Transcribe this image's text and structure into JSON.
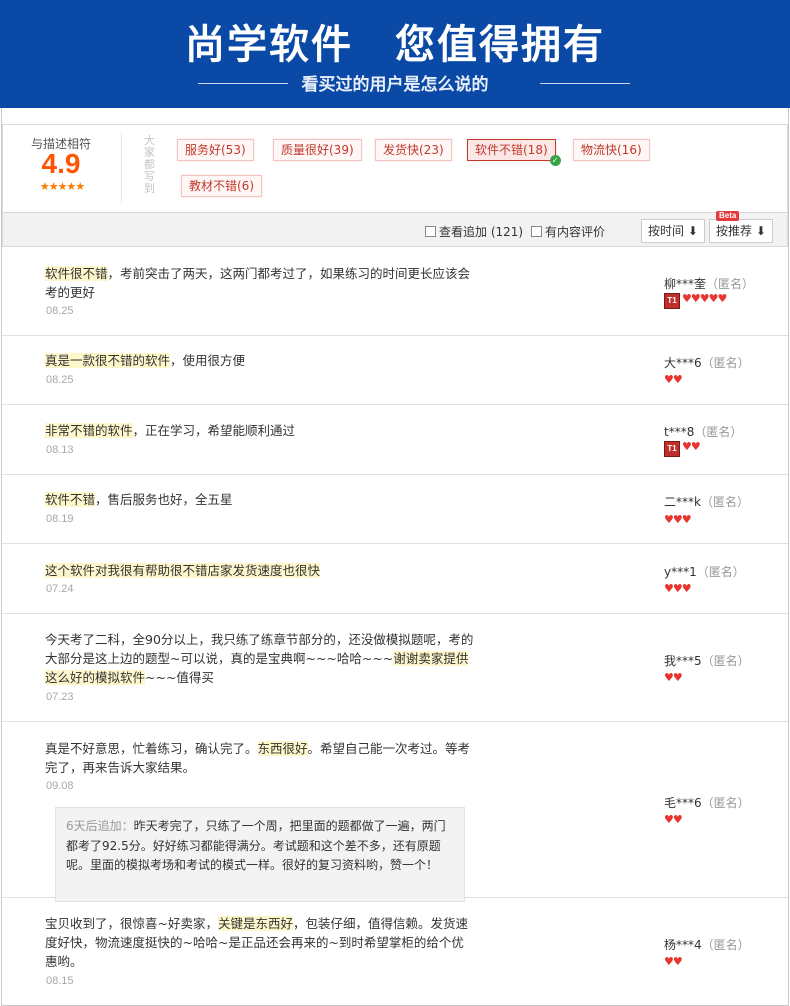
{
  "banner": {
    "title": "尚学软件　您值得拥有",
    "subtitle": "看买过的用户是怎么说的"
  },
  "summary": {
    "score_label": "与描述相符",
    "score": "4.9",
    "stars": "★★★★★",
    "tag_caption": "大家都写到",
    "tags": [
      {
        "label": "服务好(53)",
        "active": false
      },
      {
        "label": "质量很好(39)",
        "active": false
      },
      {
        "label": "发货快(23)",
        "active": false
      },
      {
        "label": "软件不错(18)",
        "active": true
      },
      {
        "label": "物流快(16)",
        "active": false
      },
      {
        "label": "教材不错(6)",
        "active": false
      }
    ]
  },
  "filters": {
    "append_label": "查看追加 (121)",
    "content_label": "有内容评价",
    "sort_time": "按时间",
    "sort_recommend": "按推荐",
    "beta": "Beta"
  },
  "reviews": [
    {
      "text_hl": "软件很不错",
      "text_rest": "，考前突击了两天，这两门都考过了，如果练习的时间更长应该会考的更好",
      "date": "08.25",
      "user": "柳***奎",
      "anon": "（匿名）",
      "badge": "T1",
      "hearts": 5
    },
    {
      "text_hl": "真是一款很不错的软件",
      "text_rest": "，使用很方便",
      "date": "08.25",
      "user": "大***6",
      "anon": "（匿名）",
      "badge": "",
      "hearts": 2
    },
    {
      "text_hl": "非常不错的软件",
      "text_rest": "，正在学习，希望能顺利通过",
      "date": "08.13",
      "user": "t***8",
      "anon": "（匿名）",
      "badge": "T1",
      "hearts": 2
    },
    {
      "text_hl": "软件不错",
      "text_rest": "，售后服务也好，全五星",
      "date": "08.19",
      "user": "二***k",
      "anon": "（匿名）",
      "badge": "",
      "hearts": 3
    },
    {
      "text_hl": "这个软件对我很有帮助很不错店家发货速度也很快",
      "text_rest": "",
      "date": "07.24",
      "user": "y***1",
      "anon": "（匿名）",
      "badge": "",
      "hearts": 3
    },
    {
      "text_pre": "今天考了二科，全90分以上，我只练了练章节部分的，还没做模拟题呢，考的大部分是这上边的题型~可以说，真的是宝典啊~~~哈哈~~~",
      "text_hl": "谢谢卖家提供这么好的模拟软件",
      "text_rest": "~~~值得买",
      "date": "07.23",
      "user": "我***5",
      "anon": "（匿名）",
      "badge": "",
      "hearts": 2
    },
    {
      "text_pre": "真是不好意思，忙着练习，确认完了。",
      "text_hl": "东西很好",
      "text_rest": "。希望自己能一次考过。等考完了，再来告诉大家结果。",
      "date": "09.08",
      "followup_lead": "6天后追加：",
      "followup_text": "昨天考完了，只练了一个周，把里面的题都做了一遍，两门都考了92.5分。好好练习都能得满分。考试题和这个差不多，还有原题呢。里面的模拟考场和考试的模式一样。很好的复习资料哟，赞一个！",
      "user": "毛***6",
      "anon": "（匿名）",
      "badge": "",
      "hearts": 2
    },
    {
      "text_pre": "宝贝收到了，很惊喜~好卖家，",
      "text_hl": "关键是东西好",
      "text_rest": "，包装仔细，值得信赖。发货速度好快，物流速度挺快的~哈哈~是正品还会再来的~到时希望掌柜的给个优惠哟。",
      "date": "08.15",
      "user": "杨***4",
      "anon": "（匿名）",
      "badge": "",
      "hearts": 2
    }
  ],
  "colors": {
    "banner_bg": "#0a4aa6",
    "score": "#ff5500",
    "tag_text": "#c0392b",
    "highlight": "#fff7cc",
    "heart": "#e8352f"
  }
}
